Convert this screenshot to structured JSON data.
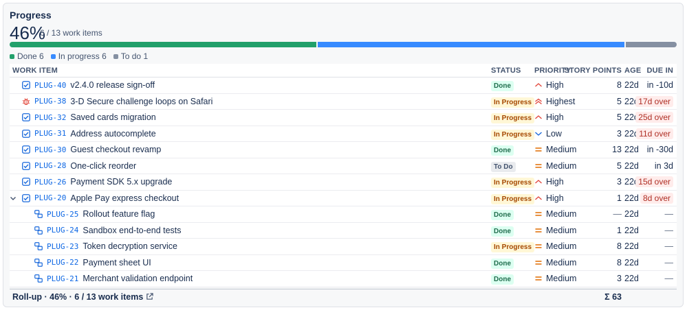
{
  "panel": {
    "title": "Progress",
    "percent": "46%",
    "summary": "6 / 13 work items",
    "bar": {
      "done": 6,
      "in_progress": 6,
      "todo": 1,
      "total": 13
    },
    "legend": [
      {
        "label": "Done 6",
        "color": "#22a06b"
      },
      {
        "label": "In progress 6",
        "color": "#388bff"
      },
      {
        "label": "To do 1",
        "color": "#8590a2"
      }
    ]
  },
  "table": {
    "headers": {
      "item": "WORK ITEM",
      "status": "STATUS",
      "priority": "PRIORITY",
      "points": "STORY POINTS",
      "age": "AGE",
      "due": "DUE IN"
    },
    "rows": [
      {
        "key": "PLUG-40",
        "title": "v2.4.0 release sign-off",
        "icon": "task-checkbox-icon",
        "status": "Done",
        "priority": "High",
        "points": "8",
        "age": "22d",
        "due": "in -10d",
        "overdue": false,
        "child": false
      },
      {
        "key": "PLUG-38",
        "title": "3-D Secure challenge loops on Safari",
        "icon": "bug-icon",
        "status": "In Progress",
        "priority": "Highest",
        "points": "5",
        "age": "22d",
        "due": "17d over",
        "overdue": true,
        "child": false
      },
      {
        "key": "PLUG-32",
        "title": "Saved cards migration",
        "icon": "task-checkbox-icon",
        "status": "In Progress",
        "priority": "High",
        "points": "5",
        "age": "22d",
        "due": "25d over",
        "overdue": true,
        "child": false
      },
      {
        "key": "PLUG-31",
        "title": "Address autocomplete",
        "icon": "task-checkbox-icon",
        "status": "In Progress",
        "priority": "Low",
        "points": "3",
        "age": "22d",
        "due": "11d over",
        "overdue": true,
        "child": false
      },
      {
        "key": "PLUG-30",
        "title": "Guest checkout revamp",
        "icon": "task-checkbox-icon",
        "status": "Done",
        "priority": "Medium",
        "points": "13",
        "age": "22d",
        "due": "in -30d",
        "overdue": false,
        "child": false
      },
      {
        "key": "PLUG-28",
        "title": "One-click reorder",
        "icon": "task-checkbox-icon",
        "status": "To Do",
        "priority": "Medium",
        "points": "5",
        "age": "22d",
        "due": "in 3d",
        "overdue": false,
        "child": false
      },
      {
        "key": "PLUG-26",
        "title": "Payment SDK 5.x upgrade",
        "icon": "task-checkbox-icon",
        "status": "In Progress",
        "priority": "High",
        "points": "3",
        "age": "22d",
        "due": "15d over",
        "overdue": true,
        "child": false
      },
      {
        "key": "PLUG-20",
        "title": "Apple Pay express checkout",
        "icon": "task-checkbox-icon",
        "status": "In Progress",
        "priority": "High",
        "points": "1",
        "age": "22d",
        "due": "8d over",
        "overdue": true,
        "child": false,
        "expandable": true
      },
      {
        "key": "PLUG-25",
        "title": "Rollout feature flag",
        "icon": "subtask-icon",
        "status": "Done",
        "priority": "Medium",
        "points": "—",
        "age": "22d",
        "due": "—",
        "overdue": false,
        "child": true
      },
      {
        "key": "PLUG-24",
        "title": "Sandbox end-to-end tests",
        "icon": "subtask-icon",
        "status": "Done",
        "priority": "Medium",
        "points": "1",
        "age": "22d",
        "due": "—",
        "overdue": false,
        "child": true
      },
      {
        "key": "PLUG-23",
        "title": "Token decryption service",
        "icon": "subtask-icon",
        "status": "In Progress",
        "priority": "Medium",
        "points": "8",
        "age": "22d",
        "due": "—",
        "overdue": false,
        "child": true
      },
      {
        "key": "PLUG-22",
        "title": "Payment sheet UI",
        "icon": "subtask-icon",
        "status": "Done",
        "priority": "Medium",
        "points": "8",
        "age": "22d",
        "due": "—",
        "overdue": false,
        "child": true
      },
      {
        "key": "PLUG-21",
        "title": "Merchant validation endpoint",
        "icon": "subtask-icon",
        "status": "Done",
        "priority": "Medium",
        "points": "3",
        "age": "22d",
        "due": "—",
        "overdue": false,
        "child": true
      }
    ]
  },
  "footer": {
    "rollup": "Roll-up · 46% · 6 / 13 work items",
    "sum": "Σ 63"
  }
}
